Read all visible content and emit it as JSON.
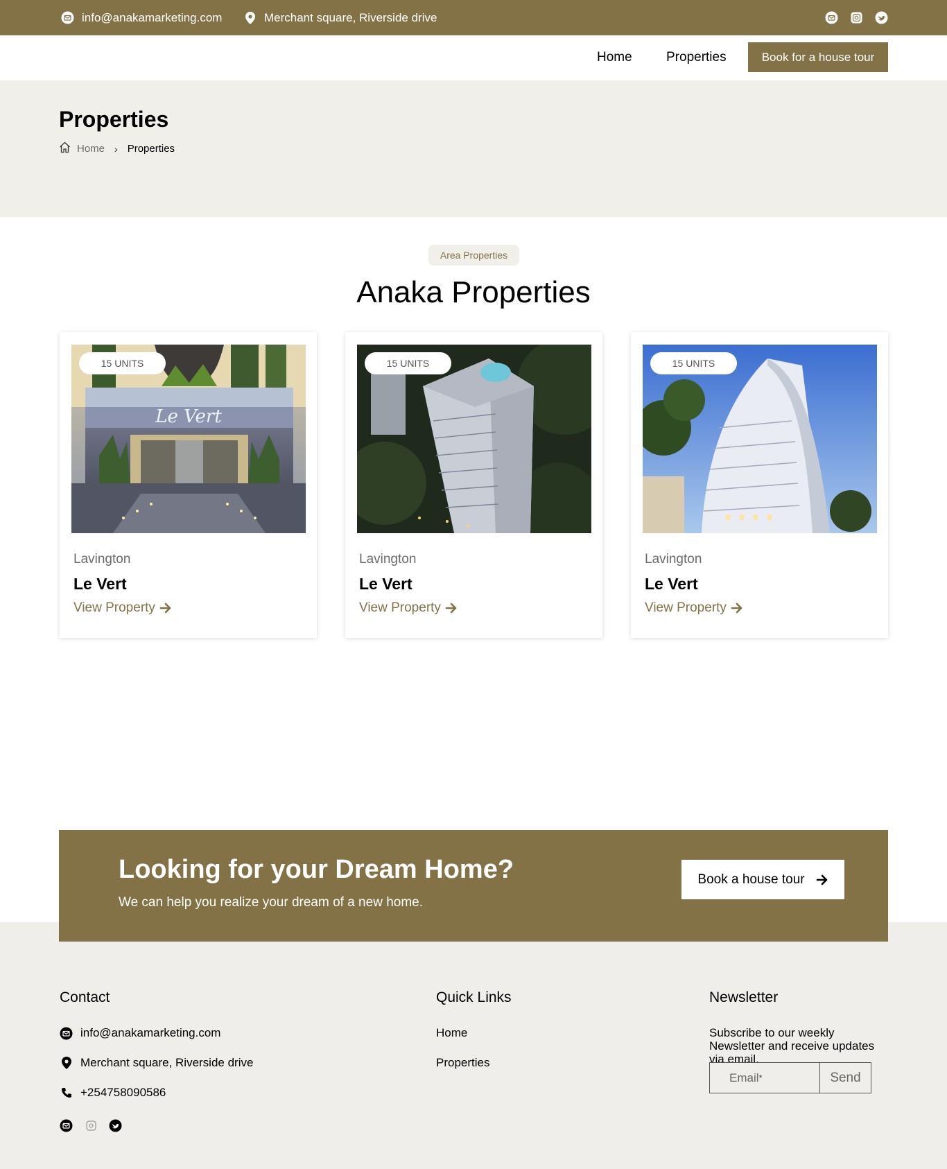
{
  "topbar": {
    "email": "info@anakamarketing.com",
    "address": "Merchant square, Riverside drive",
    "socials": [
      "mail-icon",
      "instagram-icon",
      "twitter-icon"
    ]
  },
  "nav": {
    "home": "Home",
    "properties": "Properties",
    "book": "Book for a house tour"
  },
  "hero": {
    "title": "Properties",
    "breadcrumb_home": "Home",
    "breadcrumb_sep": "›",
    "breadcrumb_current": "Properties"
  },
  "section": {
    "pill": "Area Properties",
    "title": "Anaka Properties"
  },
  "cards": [
    {
      "units": "15 UNITS",
      "location": "Lavington",
      "name": "Le Vert",
      "link": "View Property",
      "image_label": "Le Vert"
    },
    {
      "units": "15 UNITS",
      "location": "Lavington",
      "name": "Le Vert",
      "link": "View Property"
    },
    {
      "units": "15 UNITS",
      "location": "Lavington",
      "name": "Le Vert",
      "link": "View Property"
    }
  ],
  "cta": {
    "title": "Looking for your Dream Home?",
    "subtitle": "We can help you realize your dream of a new home.",
    "button": "Book a house tour"
  },
  "footer": {
    "contact_heading": "Contact",
    "email": "info@anakamarketing.com",
    "address": "Merchant square, Riverside drive",
    "phone": "+254758090586",
    "quick_links_heading": "Quick Links",
    "links": [
      "Home",
      "Properties"
    ],
    "newsletter_heading": "Newsletter",
    "newsletter_text": "Subscribe to our weekly Newsletter and receive updates via email.",
    "email_placeholder": "Email",
    "required_mark": "*",
    "send": "Send"
  },
  "colors": {
    "brand": "#827245",
    "hero_bg": "#f0efe9",
    "footer_bg": "#efeeea"
  }
}
